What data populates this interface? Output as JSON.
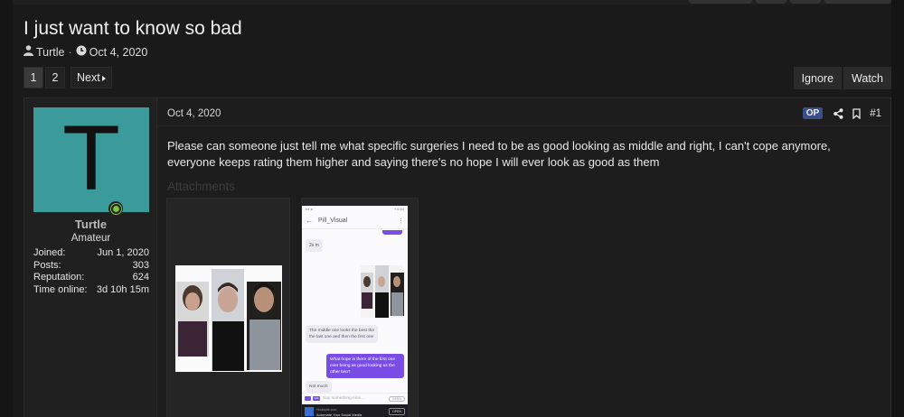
{
  "thread": {
    "title": "I just want to know so bad",
    "author": "Turtle",
    "date": "Oct 4, 2020"
  },
  "pagination": {
    "pages": [
      "1",
      "2"
    ],
    "current": "1",
    "next_label": "Next"
  },
  "thread_actions": {
    "ignore_label": "Ignore",
    "watch_label": "Watch"
  },
  "post": {
    "date": "Oct 4, 2020",
    "op_badge": "OP",
    "number": "#1",
    "body": "Please can someone just tell me what specific surgeries I need to be as good looking as middle and right, I can't cope anymore, everyone keeps rating them higher and saying there's no hope I will ever look as good as them",
    "attachments_label": "Attachments"
  },
  "user": {
    "avatar_letter": "T",
    "avatar_color": "#3b9b9b",
    "online_color": "#7cc33a",
    "name": "Turtle",
    "title": "Amateur",
    "stats": [
      {
        "label": "Joined:",
        "value": "Jun 1, 2020"
      },
      {
        "label": "Posts:",
        "value": "303"
      },
      {
        "label": "Reputation:",
        "value": "624"
      },
      {
        "label": "Time online:",
        "value": "3d 10h 15m"
      }
    ]
  },
  "screenshot_attachment": {
    "chat_name": "Pill_Visual",
    "time_label": "2s m",
    "msg_in_1": "The middle one looks the best the the last one and then the first one",
    "msg_out_1": "What hope is there of the first one ever being as good looking as the other two?",
    "msg_in_2": "Not much",
    "input_placeholder": "Say something nice...",
    "ad_source": "Hootsuite.com",
    "ad_title": "Automate Your Social Media",
    "ad_button": "OPEN"
  },
  "colors": {
    "accent_purple": "#7a4ee6",
    "op_badge_bg": "#3a4f8a"
  }
}
